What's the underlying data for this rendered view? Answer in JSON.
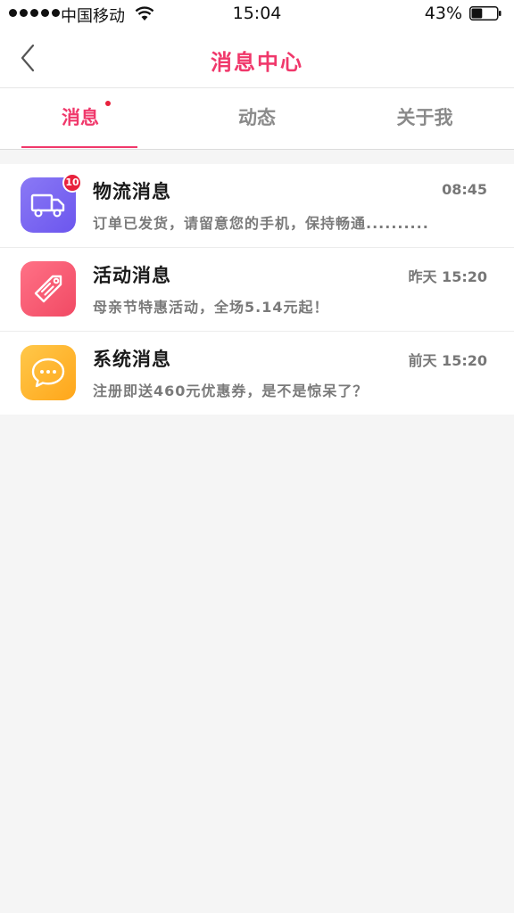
{
  "status_bar": {
    "carrier": "中国移动",
    "time": "15:04",
    "battery_percent": "43%",
    "battery_level": 0.43
  },
  "nav": {
    "title": "消息中心",
    "back_icon": "chevron-left-icon",
    "accent_color": "#f0386b"
  },
  "tabs": [
    {
      "label": "消息",
      "active": true,
      "has_dot": true
    },
    {
      "label": "动态",
      "active": false,
      "has_dot": false
    },
    {
      "label": "关于我",
      "active": false,
      "has_dot": false
    }
  ],
  "messages": [
    {
      "title": "物流消息",
      "time": "08:45",
      "preview": "订单已发货，请留意您的手机，保持畅通..........",
      "icon": "truck-icon",
      "icon_color": "#7b66f0",
      "badge": "10"
    },
    {
      "title": "活动消息",
      "time": "昨天 15:20",
      "preview": "母亲节特惠活动，全场5.14元起！",
      "icon": "tag-icon",
      "icon_color": "#f5566e"
    },
    {
      "title": "系统消息",
      "time": "前天 15:20",
      "preview": "注册即送460元优惠券，是不是惊呆了？",
      "icon": "chat-bubble-icon",
      "icon_color": "#ffb02e"
    }
  ]
}
